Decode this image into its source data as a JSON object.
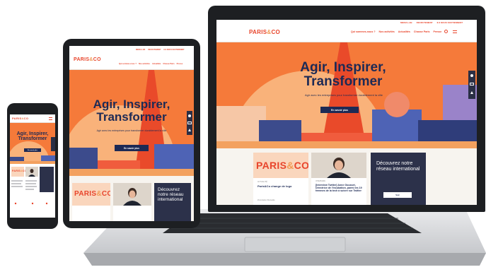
{
  "colors": {
    "brand_orange": "#e8452c",
    "hero_orange": "#f57a3a",
    "navy": "#1d2a55",
    "device_frame": "#1d1f22",
    "laptop_silver": "#d9dadc"
  },
  "site": {
    "logo": "PARIS&CO",
    "logo_part1": "PARIS",
    "logo_amp": "&",
    "logo_part2": "CO",
    "logo_card_part1": "PARIS",
    "logo_card_amp": "&",
    "logo_card_part2": "CO",
    "top_links": [
      "MEDIA LAB",
      "RECRUTEMENT",
      "ILS NOUS SOUTIENNENT"
    ],
    "nav": [
      "Qui sommes-nous ?",
      "Nos activités",
      "Actualités",
      "Chasse Paris",
      "Presse"
    ],
    "hero_title": "Agir, Inspirer,\nTransformer",
    "hero_subtitle": "Agir avec les entreprises pour transformer durablement la ville",
    "hero_button": "En savoir plus",
    "cards": [
      {
        "category": "ACTUALITÉ",
        "title": "Paris&Co change de logo",
        "meta": "#incubation  #Actualité"
      },
      {
        "category": "INTERVIEW",
        "title": "[Interview Twitter] Anne Gousset, Directrice de l'incubation, parmi les 19 femmes de la tech à suivre sur Twitter",
        "meta": ""
      },
      {
        "title": "Découvrez notre réseau international",
        "button": "Voir"
      }
    ]
  }
}
